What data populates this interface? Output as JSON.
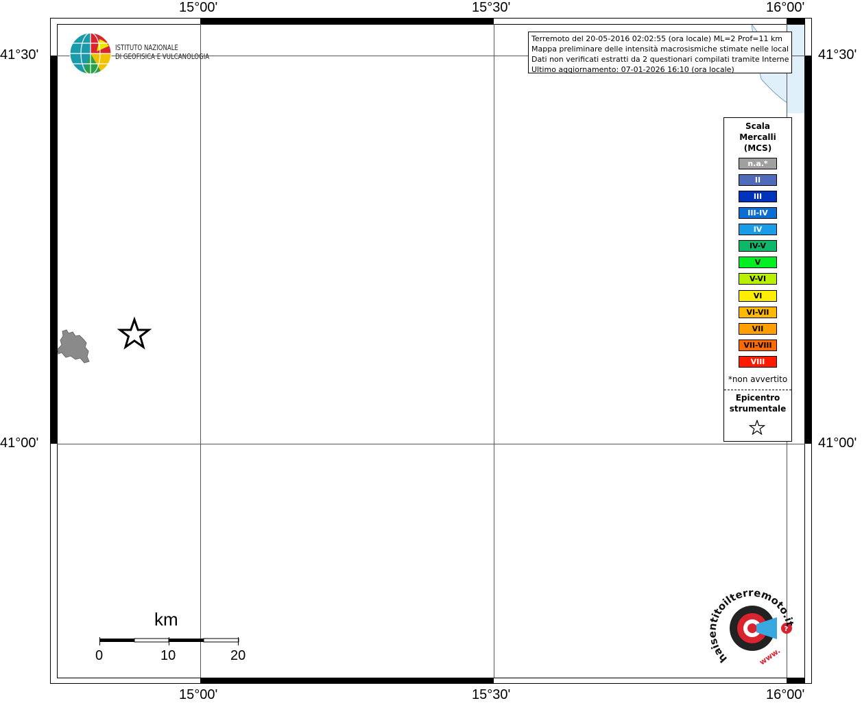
{
  "map": {
    "lon_labels": [
      "15°00'",
      "15°30'",
      "16°00'"
    ],
    "lat_labels": [
      "41°30'",
      "41°00'"
    ]
  },
  "org_logo": {
    "line1": "ISTITUTO NAZIONALE",
    "line2": "DI GEOFISICA E VULCANOLOGIA"
  },
  "info_box": {
    "line1": "Terremoto del 20-05-2016 02:02:55 (ora locale) ML=2 Prof=11 km",
    "line2": "Mappa preliminare delle intensità macrosismiche stimate nelle località",
    "line3": "Dati non verificati estratti da 2 questionari compilati tramite Internet.",
    "line4": "Ultimo aggiornamento: 07-01-2026 16:10 (ora locale)"
  },
  "legend": {
    "title_line1": "Scala",
    "title_line2": "Mercalli",
    "title_line3": "(MCS)",
    "classes": [
      {
        "label": "n.a.*",
        "color": "#a0a0a0"
      },
      {
        "label": "II",
        "color": "#4f6cb8"
      },
      {
        "label": "III",
        "color": "#0033bb"
      },
      {
        "label": "III-IV",
        "color": "#0a6ed2"
      },
      {
        "label": "IV",
        "color": "#1a9de6"
      },
      {
        "label": "IV-V",
        "color": "#0db86a"
      },
      {
        "label": "V",
        "color": "#00ee22"
      },
      {
        "label": "V-VI",
        "color": "#b8f000"
      },
      {
        "label": "VI",
        "color": "#ffee00"
      },
      {
        "label": "VI-VII",
        "color": "#ffb800"
      },
      {
        "label": "VII",
        "color": "#ffa000"
      },
      {
        "label": "VII-VIII",
        "color": "#ff6a00"
      },
      {
        "label": "VIII",
        "color": "#ff1a00"
      }
    ],
    "note": "*non avvertito",
    "epicenter_line1": "Epicentro",
    "epicenter_line2": "strumentale"
  },
  "scale_bar": {
    "unit": "km",
    "ticks": [
      "0",
      "10",
      "20"
    ]
  },
  "site_logo": {
    "text": "haisentitoilterremoto.it",
    "prefix": "www."
  }
}
